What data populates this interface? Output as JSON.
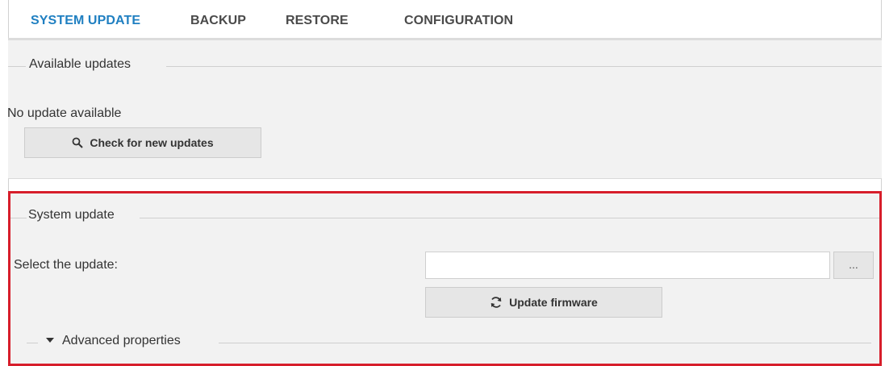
{
  "tabs": [
    {
      "label": "SYSTEM UPDATE",
      "active": true
    },
    {
      "label": "BACKUP",
      "active": false
    },
    {
      "label": "RESTORE",
      "active": false
    },
    {
      "label": "CONFIGURATION",
      "active": false
    }
  ],
  "available_updates": {
    "legend": "Available updates",
    "status": "No update available",
    "check_button": "Check for new updates"
  },
  "system_update": {
    "legend": "System update",
    "select_label": "Select the update:",
    "file_value": "",
    "browse_label": "...",
    "update_button": "Update firmware",
    "advanced_label": "Advanced properties"
  },
  "colors": {
    "accent": "#1f7fc1",
    "highlight_border": "#d71e2b",
    "panel_bg": "#f2f2f2"
  }
}
